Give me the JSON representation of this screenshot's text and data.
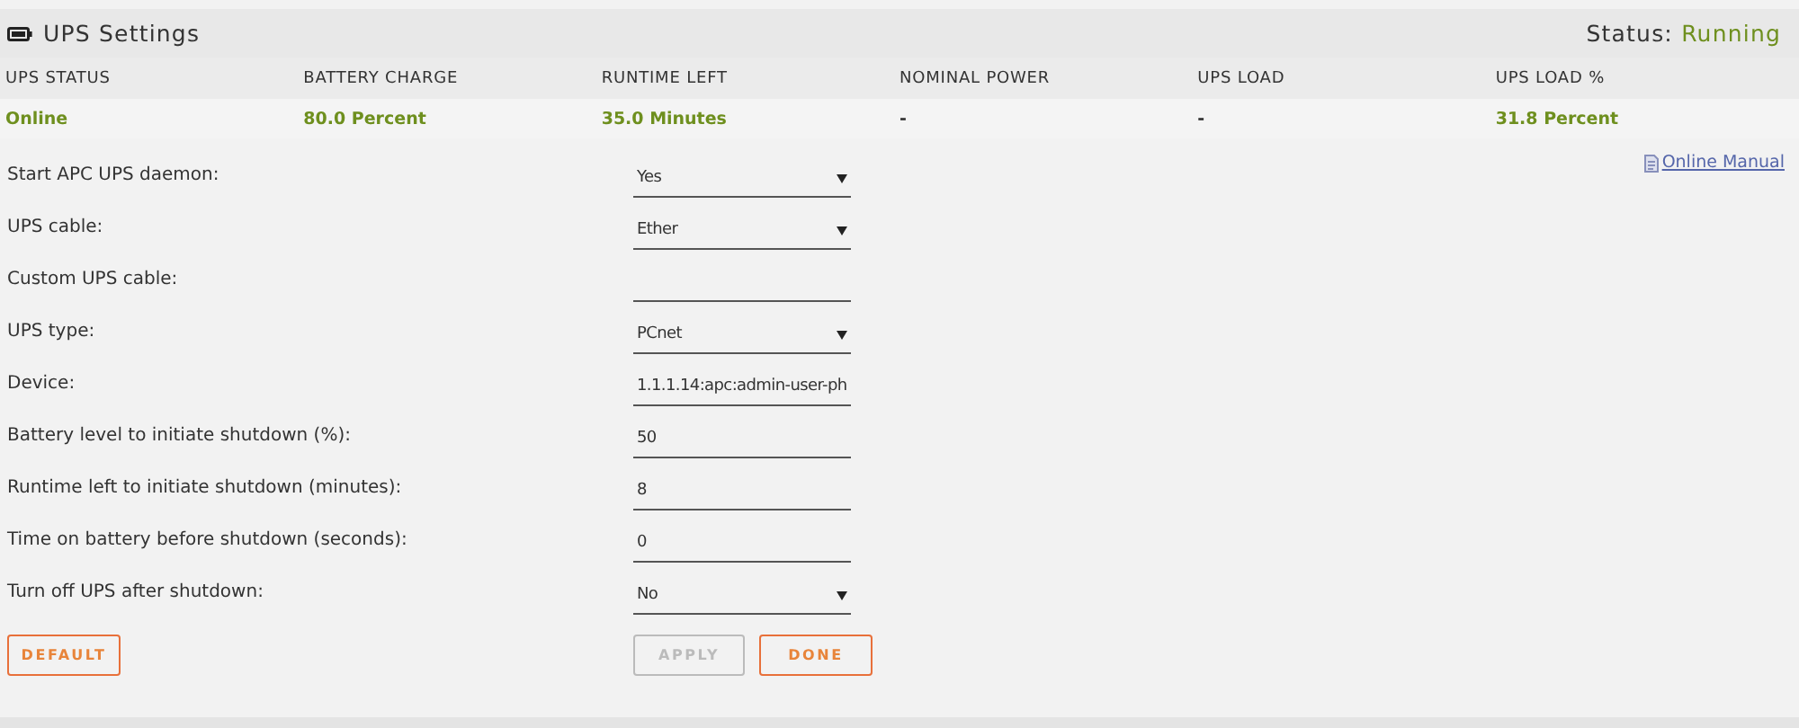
{
  "panel": {
    "title": "UPS Settings",
    "status_label": "Status:",
    "status_value": "Running"
  },
  "status_table": {
    "columns": [
      "UPS STATUS",
      "BATTERY CHARGE",
      "RUNTIME LEFT",
      "NOMINAL POWER",
      "UPS LOAD",
      "UPS LOAD %"
    ],
    "row": [
      {
        "text": "Online",
        "highlight": true
      },
      {
        "text": "80.0 Percent",
        "highlight": true
      },
      {
        "text": "35.0 Minutes",
        "highlight": true
      },
      {
        "text": "-",
        "highlight": false
      },
      {
        "text": "-",
        "highlight": false
      },
      {
        "text": "31.8 Percent",
        "highlight": true
      }
    ]
  },
  "manual_link": "Online Manual",
  "settings": [
    {
      "label": "Start APC UPS daemon:",
      "kind": "select",
      "value": "Yes"
    },
    {
      "label": "UPS cable:",
      "kind": "select",
      "value": "Ether"
    },
    {
      "label": "Custom UPS cable:",
      "kind": "input"
    },
    {
      "label": "UPS type:",
      "kind": "select",
      "value": "PCnet"
    },
    {
      "label": "Device:",
      "kind": "input",
      "value": "1.1.1.14:apc:admin-user-ph"
    },
    {
      "label": "Battery level to initiate shutdown (%):",
      "kind": "input",
      "value": "50"
    },
    {
      "label": "Runtime left to initiate shutdown (minutes):",
      "kind": "input",
      "value": "8"
    },
    {
      "label": "Time on battery before shutdown (seconds):",
      "kind": "input",
      "value": "0"
    },
    {
      "label": "Turn off UPS after shutdown:",
      "kind": "select",
      "value": "No"
    }
  ],
  "buttons": [
    {
      "label": "DEFAULT",
      "disabled": false
    },
    {
      "label": "APPLY",
      "disabled": true
    },
    {
      "label": "DONE",
      "disabled": false
    }
  ]
}
